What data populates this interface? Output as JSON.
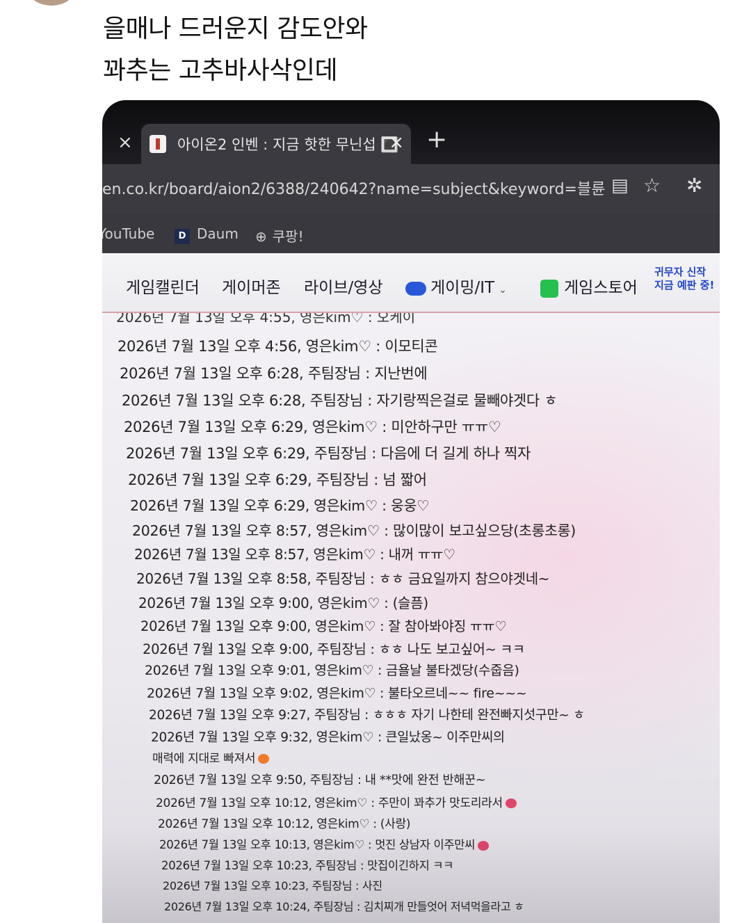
{
  "post": {
    "line1": "을매나 드러운지 감도안와",
    "line2": "꽈추는 고추바사삭인데"
  },
  "browser": {
    "tab_title": "아이온2 인벤 : 지금 핫한 무닌섭 🔳",
    "tab_close": "×",
    "prev_tab_close": "×",
    "new_tab": "+",
    "url": "en.co.kr/board/aion2/6388/240642?name=subject&keyword=블륜",
    "bookmarks": [
      "YouTube",
      "Daum",
      "쿠팡!"
    ],
    "icons": [
      "reader-icon",
      "star-icon",
      "extension-icon"
    ]
  },
  "site_nav": {
    "items": [
      "게임캘린더",
      "게이머존",
      "라이브/영상",
      "게이밍/IT",
      "게임스토어"
    ],
    "promo_line1": "귀무자 신작",
    "promo_line2": "지금 예판 중!"
  },
  "chat": {
    "cut_line": "2026년 7월 13일 오후 4:55, 영은kim♡ : 오케이",
    "messages": [
      "2026년 7월 13일 오후 4:56, 영은kim♡ : 이모티콘",
      "2026년 7월 13일 오후 6:28, 주팀장님 : 지난번에",
      "2026년 7월 13일 오후 6:28, 주팀장님 : 자기랑찍은걸로 물빼야겟다 ㅎ",
      "2026년 7월 13일 오후 6:29, 영은kim♡ : 미안하구만 ㅠㅠ♡",
      "2026년 7월 13일 오후 6:29, 주팀장님 : 다음에 더 길게 하나 찍자",
      "2026년 7월 13일 오후 6:29, 주팀장님 : 넘 짧어",
      "2026년 7월 13일 오후 6:29, 영은kim♡ : 웅웅♡",
      "2026년 7월 13일 오후 8:57, 영은kim♡ : 많이많이 보고싶으당(초롱초롱)",
      "2026년 7월 13일 오후 8:57, 영은kim♡ : 내꺼 ㅠㅠ♡",
      "2026년 7월 13일 오후 8:58, 주팀장님 : ㅎㅎ 금요일까지 참으야겟네~",
      "2026년 7월 13일 오후 9:00, 영은kim♡ : (슬픔)",
      "2026년 7월 13일 오후 9:00, 영은kim♡ : 잘 참아봐야징 ㅠㅠ♡",
      "2026년 7월 13일 오후 9:00, 주팀장님 : ㅎㅎ 나도 보고싶어~ ㅋㅋ",
      "2026년 7월 13일 오후 9:01, 영은kim♡ : 금욜날 불타겠당(수줍음)",
      "2026년 7월 13일 오후 9:02, 영은kim♡ : 불타오르네~~ fire~~~",
      "2026년 7월 13일 오후 9:27, 주팀장님 : ㅎㅎㅎ 자기 나한테 완전빠지섯구만~ ㅎ",
      "2026년 7월 13일 오후 9:32, 영은kim♡ : 큰일났옹~ 이주만씨의",
      "매력에 지대로 빠져서",
      "2026년 7월 13일 오후 9:50, 주팀장님 : 내 **맛에 완전 반해꾼~",
      "2026년 7월 13일 오후 10:12, 영은kim♡ : 주만이 꽈추가 맛도리라서",
      "2026년 7월 13일 오후 10:12, 영은kim♡ : (사랑)",
      "2026년 7월 13일 오후 10:13, 영은kim♡ : 멋진 상남자 이주만씨",
      "2026년 7월 13일 오후 10:23, 주팀장님 : 맛집이긴하지 ㅋㅋ",
      "2026년 7월 13일 오후 10:23, 주팀장님 : 사진",
      "2026년 7월 13일 오후 10:24, 주팀장님 : 김치찌개 만들엇어 저녁먹을라고 ㅎ"
    ]
  }
}
